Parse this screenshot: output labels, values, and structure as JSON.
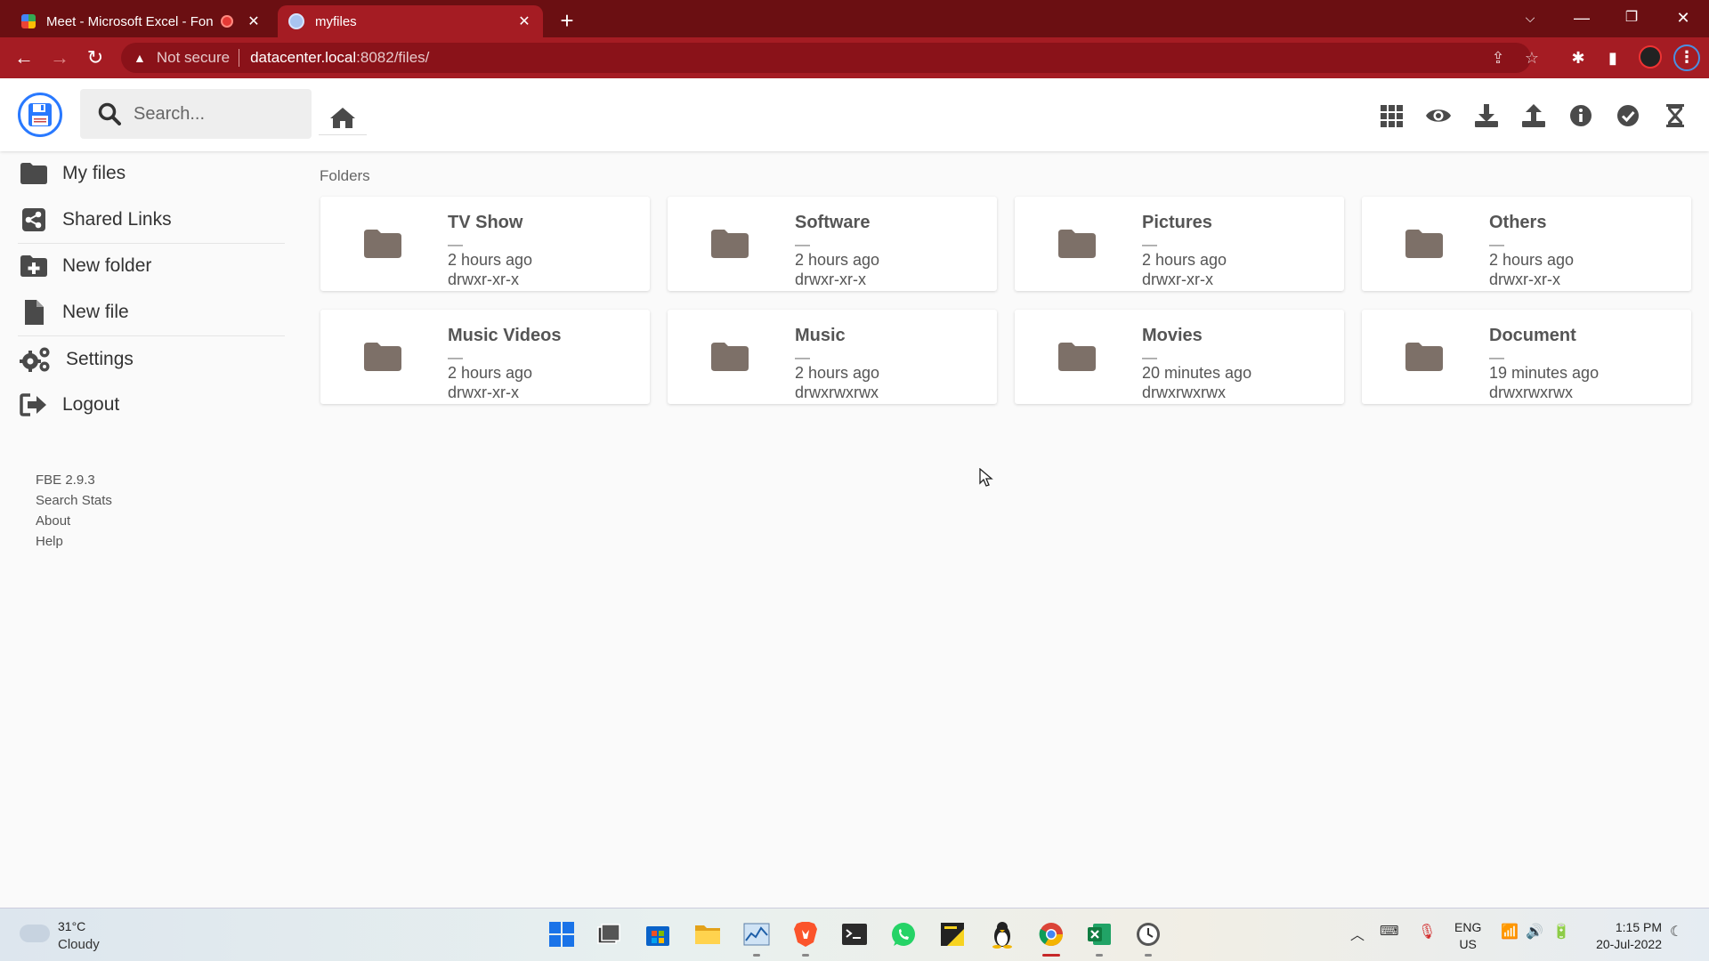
{
  "browser": {
    "tabs": [
      {
        "title": "Meet - Microsoft Excel - Fon",
        "active": false
      },
      {
        "title": "myfiles",
        "active": true
      }
    ],
    "new_tab": "+",
    "security_label": "Not secure",
    "url_host": "datacenter.local",
    "url_path": ":8082/files/"
  },
  "header": {
    "search_placeholder": "Search...",
    "actions": [
      "grid-view",
      "preview",
      "download",
      "upload",
      "info",
      "select",
      "progress"
    ]
  },
  "sidebar": {
    "items": [
      {
        "label": "My files",
        "icon": "folder-icon"
      },
      {
        "label": "Shared Links",
        "icon": "share-icon"
      },
      {
        "label": "New folder",
        "icon": "folder-plus-icon"
      },
      {
        "label": "New file",
        "icon": "file-icon"
      },
      {
        "label": "Settings",
        "icon": "gears-icon"
      },
      {
        "label": "Logout",
        "icon": "logout-icon"
      }
    ],
    "footer": {
      "version": "FBE 2.9.3",
      "search_stats": "Search Stats",
      "about": "About",
      "help": "Help"
    }
  },
  "main": {
    "section_label": "Folders",
    "folders": [
      {
        "name": "TV Show",
        "size": "—",
        "modified": "2 hours ago",
        "permissions": "drwxr-xr-x"
      },
      {
        "name": "Software",
        "size": "—",
        "modified": "2 hours ago",
        "permissions": "drwxr-xr-x"
      },
      {
        "name": "Pictures",
        "size": "—",
        "modified": "2 hours ago",
        "permissions": "drwxr-xr-x"
      },
      {
        "name": "Others",
        "size": "—",
        "modified": "2 hours ago",
        "permissions": "drwxr-xr-x"
      },
      {
        "name": "Music Videos",
        "size": "—",
        "modified": "2 hours ago",
        "permissions": "drwxr-xr-x"
      },
      {
        "name": "Music",
        "size": "—",
        "modified": "2 hours ago",
        "permissions": "drwxrwxrwx"
      },
      {
        "name": "Movies",
        "size": "—",
        "modified": "20 minutes ago",
        "permissions": "drwxrwxrwx"
      },
      {
        "name": "Document",
        "size": "—",
        "modified": "19 minutes ago",
        "permissions": "drwxrwxrwx"
      }
    ]
  },
  "taskbar": {
    "weather_temp": "31°C",
    "weather_condition": "Cloudy",
    "language": "ENG",
    "region": "US",
    "time": "1:15 PM",
    "date": "20-Jul-2022"
  },
  "colors": {
    "tab_bar": "#6b0f12",
    "active_tab": "#a51c23",
    "accent_blue": "#2979ff",
    "folder_icon": "#7d7068",
    "icon_dark": "#4a4a4a"
  }
}
